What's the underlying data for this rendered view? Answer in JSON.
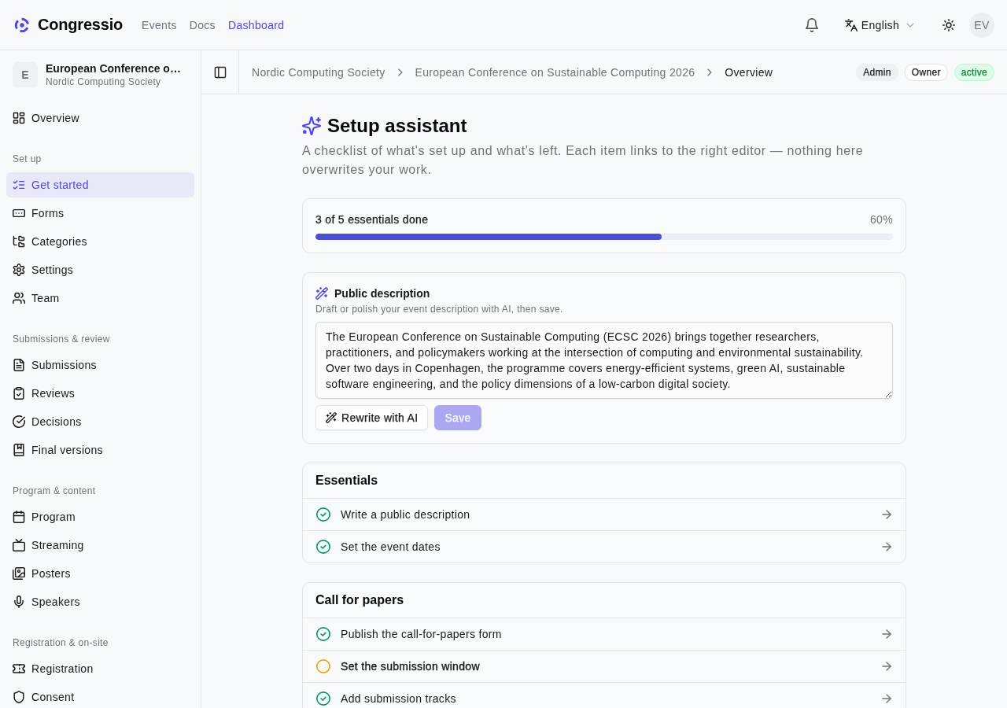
{
  "top_bar": {
    "brand": "Congressio",
    "nav": [
      {
        "label": "Events",
        "selected": false
      },
      {
        "label": "Docs",
        "selected": false
      },
      {
        "label": "Dashboard",
        "selected": true
      }
    ],
    "language": "English",
    "user_initials": "EV"
  },
  "sidebar": {
    "event": {
      "initial": "E",
      "name": "European Conference o…",
      "organization": "Nordic Computing Society"
    },
    "sections": [
      {
        "items": [
          {
            "label": "Overview",
            "selected": false
          }
        ]
      },
      {
        "heading": "Set up",
        "items": [
          {
            "label": "Get started",
            "selected": true
          },
          {
            "label": "Forms",
            "selected": false
          },
          {
            "label": "Categories",
            "selected": false
          },
          {
            "label": "Settings",
            "selected": false
          },
          {
            "label": "Team",
            "selected": false
          }
        ]
      },
      {
        "heading": "Submissions & review",
        "items": [
          {
            "label": "Submissions",
            "selected": false
          },
          {
            "label": "Reviews",
            "selected": false
          },
          {
            "label": "Decisions",
            "selected": false
          },
          {
            "label": "Final versions",
            "selected": false
          }
        ]
      },
      {
        "heading": "Program & content",
        "items": [
          {
            "label": "Program",
            "selected": false
          },
          {
            "label": "Streaming",
            "selected": false
          },
          {
            "label": "Posters",
            "selected": false
          },
          {
            "label": "Speakers",
            "selected": false
          }
        ]
      },
      {
        "heading": "Registration & on-site",
        "items": [
          {
            "label": "Registration",
            "selected": false
          },
          {
            "label": "Consent",
            "selected": false
          }
        ]
      }
    ]
  },
  "header_bar": {
    "breadcrumb": [
      {
        "label": "Nordic Computing Society",
        "current": false
      },
      {
        "label": "European Conference on Sustainable Computing 2026",
        "current": false
      },
      {
        "label": "Overview",
        "current": true
      }
    ],
    "badges": [
      {
        "label": "Admin",
        "kind": "filled"
      },
      {
        "label": "Owner",
        "kind": "outlined"
      },
      {
        "label": "active",
        "kind": "success"
      }
    ]
  },
  "page_header": {
    "title": "Setup assistant",
    "description": "A checklist of what's set up and what's left. Each item links to the right editor — nothing here overwrites your work."
  },
  "progress": {
    "label": "3 of 5 essentials done",
    "percent": "60%",
    "level": 0.6
  },
  "description_card": {
    "title": "Public description",
    "hint": "Draft or polish your event description with AI, then save.",
    "value": "The European Conference on Sustainable Computing (ECSC 2026) brings together researchers, practitioners, and policymakers working at the intersection of computing and environmental sustainability. Over two days in Copenhagen, the programme covers energy-efficient systems, green AI, sustainable software engineering, and the policy dimensions of a low-carbon digital society.",
    "buttons": [
      {
        "label": "Rewrite with AI",
        "kind": "secondary",
        "disabled": false
      },
      {
        "label": "Save",
        "kind": "primary",
        "disabled": true
      }
    ]
  },
  "checklists": [
    {
      "title": "Essentials",
      "items": [
        {
          "label": "Write a public description",
          "done": true
        },
        {
          "label": "Set the event dates",
          "done": true
        }
      ]
    },
    {
      "title": "Call for papers",
      "items": [
        {
          "label": "Publish the call-for-papers form",
          "done": true
        },
        {
          "label": "Set the submission window",
          "done": false
        },
        {
          "label": "Add submission tracks",
          "done": true
        }
      ]
    }
  ]
}
